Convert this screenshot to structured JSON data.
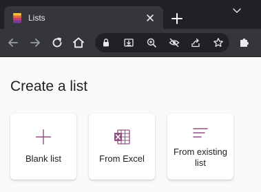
{
  "browser": {
    "tab": {
      "title": "Lists",
      "favicon": "microsoft-lists-icon"
    },
    "toolbar_icons": [
      "back-arrow-icon",
      "forward-arrow-icon",
      "reload-icon",
      "home-icon"
    ],
    "omnibox_icons": [
      "lock-icon",
      "install-app-icon",
      "zoom-icon",
      "tracking-protection-icon",
      "share-icon",
      "bookmark-star-icon"
    ],
    "extension_icon": "extensions-puzzle-icon"
  },
  "page": {
    "title": "Create a list",
    "cards": [
      {
        "label": "Blank list",
        "icon": "plus-icon"
      },
      {
        "label": "From Excel",
        "icon": "excel-icon"
      },
      {
        "label": "From existing list",
        "icon": "lines-icon"
      }
    ]
  },
  "colors": {
    "accent": "#8e4f82",
    "page_background": "#faf9f8",
    "browser_dark": "#202124",
    "toolbar": "#35363a"
  }
}
